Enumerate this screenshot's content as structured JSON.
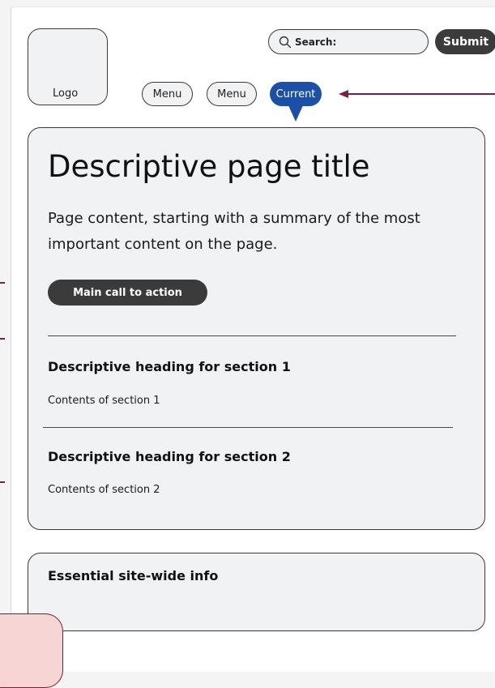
{
  "header": {
    "logo_label": "Logo",
    "search_label": "Search:",
    "submit_label": "Submit"
  },
  "nav": {
    "items": [
      {
        "label": "Menu"
      },
      {
        "label": "Menu"
      }
    ],
    "current_label": "Current"
  },
  "main": {
    "title": "Descriptive page title",
    "summary": "Page content, starting with a summary of the most important content on the page.",
    "cta_label": "Main call to action",
    "sections": [
      {
        "heading": "Descriptive heading for section 1",
        "content": "Contents of section 1"
      },
      {
        "heading": "Descriptive heading for section 2",
        "content": "Contents of section 2"
      }
    ]
  },
  "footer": {
    "title": "Essential site-wide info"
  },
  "colors": {
    "current_nav": "#1c4fa6",
    "dark_button": "#3b3b3b",
    "card_bg": "#f1f2f4",
    "annotation": "#7a1f45",
    "corner_fill": "#f7d5d5"
  },
  "icons": {
    "search": "search-icon",
    "annotation_arrow": "arrow-left-icon"
  }
}
